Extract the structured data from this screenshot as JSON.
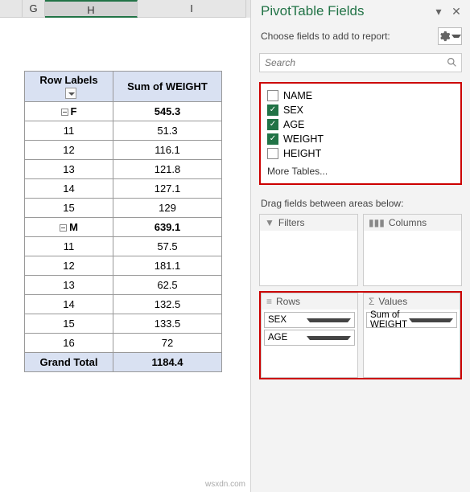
{
  "columns": {
    "g": "G",
    "h": "H",
    "i": "I"
  },
  "pivot": {
    "headers": {
      "row_labels": "Row Labels",
      "sum_weight": "Sum of WEIGHT"
    },
    "groups": [
      {
        "label": "F",
        "total": "545.3",
        "rows": [
          {
            "age": "11",
            "val": "51.3"
          },
          {
            "age": "12",
            "val": "116.1"
          },
          {
            "age": "13",
            "val": "121.8"
          },
          {
            "age": "14",
            "val": "127.1"
          },
          {
            "age": "15",
            "val": "129"
          }
        ]
      },
      {
        "label": "M",
        "total": "639.1",
        "rows": [
          {
            "age": "11",
            "val": "57.5"
          },
          {
            "age": "12",
            "val": "181.1"
          },
          {
            "age": "13",
            "val": "62.5"
          },
          {
            "age": "14",
            "val": "132.5"
          },
          {
            "age": "15",
            "val": "133.5"
          },
          {
            "age": "16",
            "val": "72"
          }
        ]
      }
    ],
    "grand_total": {
      "label": "Grand Total",
      "val": "1184.4"
    }
  },
  "pane": {
    "title": "PivotTable Fields",
    "subtitle": "Choose fields to add to report:",
    "search_placeholder": "Search",
    "fields": [
      {
        "name": "NAME",
        "checked": false
      },
      {
        "name": "SEX",
        "checked": true
      },
      {
        "name": "AGE",
        "checked": true
      },
      {
        "name": "WEIGHT",
        "checked": true
      },
      {
        "name": "HEIGHT",
        "checked": false
      }
    ],
    "more_tables": "More Tables...",
    "drag_label": "Drag fields between areas below:",
    "areas": {
      "filters_label": "Filters",
      "columns_label": "Columns",
      "rows_label": "Rows",
      "values_label": "Values",
      "rows": [
        "SEX",
        "AGE"
      ],
      "values": [
        "Sum of WEIGHT"
      ]
    }
  },
  "watermark": "wsxdn.com"
}
